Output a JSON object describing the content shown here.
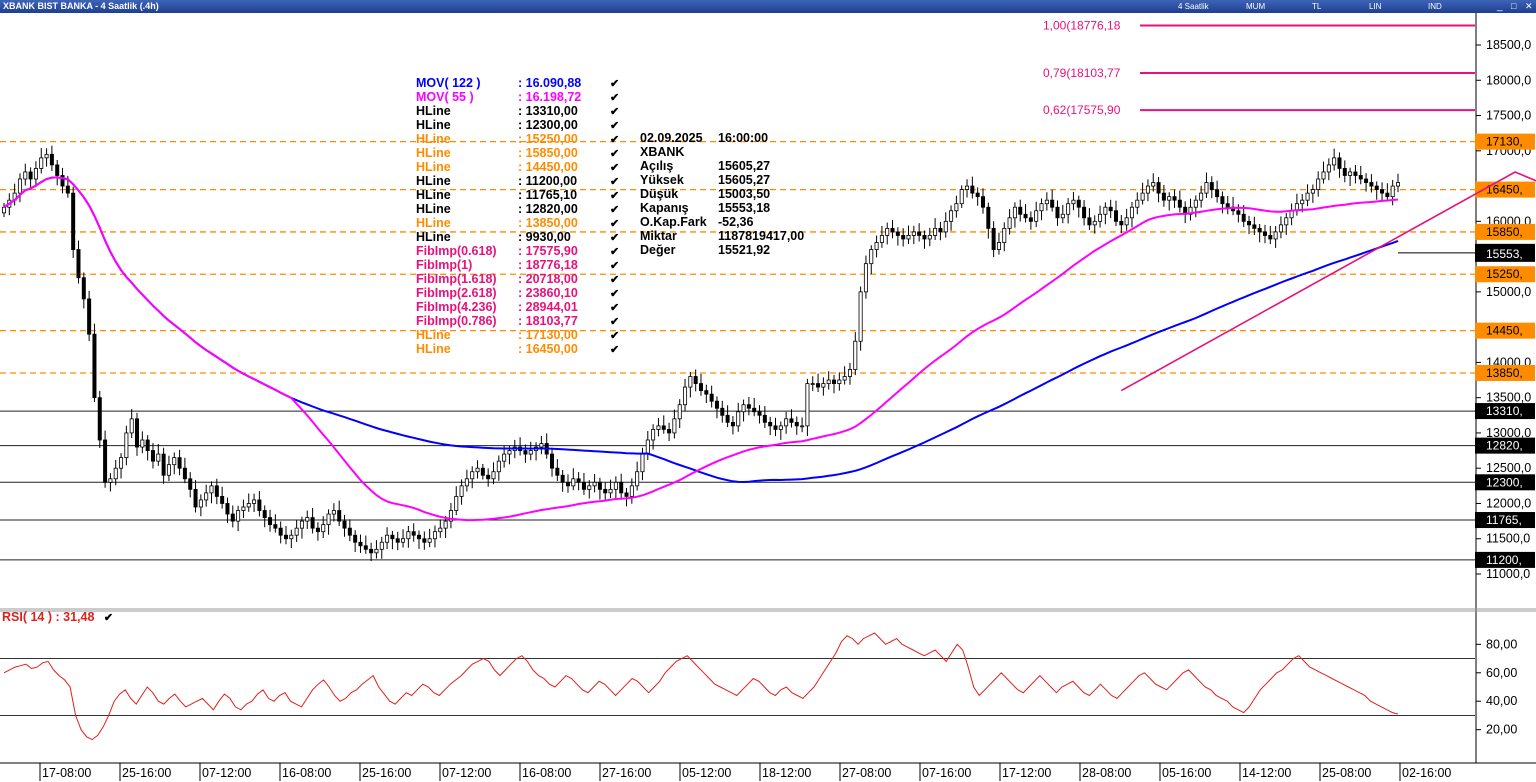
{
  "window": {
    "title": "XBANK BIST BANKA - 4 Saatlik (.4h)",
    "toolbar": [
      "4 Saatlik",
      "MUM",
      "TL",
      "LIN",
      "IND"
    ]
  },
  "legend": [
    {
      "name": "MOV( 122 )",
      "value": ": 16.090,88",
      "color": "#0000ff"
    },
    {
      "name": "MOV( 55 )",
      "value": ": 16.198,72",
      "color": "#ff00ff"
    },
    {
      "name": "HLine",
      "value": ": 13310,00",
      "color": "#000000"
    },
    {
      "name": "HLine",
      "value": ": 12300,00",
      "color": "#000000"
    },
    {
      "name": "HLine",
      "value": ": 15250,00",
      "color": "#ff8c00"
    },
    {
      "name": "HLine",
      "value": ": 15850,00",
      "color": "#ff8c00"
    },
    {
      "name": "HLine",
      "value": ": 14450,00",
      "color": "#ff8c00"
    },
    {
      "name": "HLine",
      "value": ": 11200,00",
      "color": "#000000"
    },
    {
      "name": "HLine",
      "value": ": 11765,10",
      "color": "#000000"
    },
    {
      "name": "HLine",
      "value": ": 12820,00",
      "color": "#000000"
    },
    {
      "name": "HLine",
      "value": ": 13850,00",
      "color": "#ff8c00"
    },
    {
      "name": "HLine",
      "value": ": 9930,00",
      "color": "#000000"
    },
    {
      "name": "FibImp(0.618)",
      "value": ": 17575,90",
      "color": "#e8117c"
    },
    {
      "name": "FibImp(1)",
      "value": ": 18776,18",
      "color": "#e8117c"
    },
    {
      "name": "FibImp(1.618)",
      "value": ": 20718,00",
      "color": "#e8117c"
    },
    {
      "name": "FibImp(2.618)",
      "value": ": 23860,10",
      "color": "#e8117c"
    },
    {
      "name": "FibImp(4.236)",
      "value": ": 28944,01",
      "color": "#e8117c"
    },
    {
      "name": "FibImp(0.786)",
      "value": ": 18103,77",
      "color": "#e8117c"
    },
    {
      "name": "HLine",
      "value": ": 17130,00",
      "color": "#ff8c00"
    },
    {
      "name": "HLine",
      "value": ": 16450,00",
      "color": "#ff8c00"
    }
  ],
  "ohlc": [
    {
      "k": "02.09.2025",
      "v": "16:00:00"
    },
    {
      "k": "XBANK",
      "v": ""
    },
    {
      "k": "Açılış",
      "v": "15605,27"
    },
    {
      "k": "Yüksek",
      "v": "15605,27"
    },
    {
      "k": "Düşük",
      "v": "15003,50"
    },
    {
      "k": "Kapanış",
      "v": "15553,18"
    },
    {
      "k": "O.Kap.Fark",
      "v": "-52,36"
    },
    {
      "k": "Miktar",
      "v": "1187819417,00"
    },
    {
      "k": "Değer",
      "v": "15521,92"
    }
  ],
  "rsi_label": "RSI( 14 )   : 31,48",
  "chart_data": [
    {
      "type": "candlestick",
      "y_ticks": [
        "18500,0",
        "18000,0",
        "17500,0",
        "17000,0",
        "16000,0",
        "15000,0",
        "14000,0",
        "13500,0",
        "13000,0",
        "12500,0",
        "12000,0",
        "11500,0",
        "11000,0"
      ],
      "x_ticks": [
        "17-08:00",
        "25-16:00",
        "07-12:00",
        "16-08:00",
        "25-16:00",
        "07-12:00",
        "16-08:00",
        "27-16:00",
        "05-12:00",
        "18-12:00",
        "27-08:00",
        "07-16:00",
        "17-12:00",
        "28-08:00",
        "05-16:00",
        "14-12:00",
        "25-08:00",
        "02-16:00"
      ],
      "ylim": [
        10800,
        19000
      ],
      "hlines_orange": [
        {
          "value": 17130,
          "label": "17130,"
        },
        {
          "value": 16450,
          "label": "16450,"
        },
        {
          "value": 15850,
          "label": "15850,"
        },
        {
          "value": 15250,
          "label": "15250,"
        },
        {
          "value": 14450,
          "label": "14450,"
        },
        {
          "value": 13850,
          "label": "13850,"
        }
      ],
      "hlines_black": [
        {
          "value": 13310,
          "label": "13310,"
        },
        {
          "value": 12820,
          "label": "12820,"
        },
        {
          "value": 12300,
          "label": "12300,"
        },
        {
          "value": 11765.1,
          "label": "11765,"
        },
        {
          "value": 11200,
          "label": "11200,"
        }
      ],
      "fib_levels": [
        {
          "value": 18776.18,
          "label": "1,00(18776,18"
        },
        {
          "value": 18103.77,
          "label": "0,79(18103,77"
        },
        {
          "value": 17575.9,
          "label": "0,62(17575,90"
        }
      ],
      "last_price": {
        "value": 15553.18,
        "label": "15553,"
      },
      "fib_swing": [
        {
          "i": 210,
          "y": 13600
        },
        {
          "i": 284,
          "y": 16700
        },
        {
          "i": 314,
          "y": 15750
        }
      ],
      "mov_55_color": "#ff00ff",
      "mov_122_color": "#0000ff",
      "close": [
        16200,
        16300,
        16400,
        16600,
        16700,
        16600,
        16750,
        16900,
        16950,
        16800,
        16650,
        16500,
        16400,
        15600,
        15200,
        14900,
        14400,
        13500,
        12900,
        12300,
        12350,
        12500,
        12650,
        13000,
        13200,
        12800,
        12900,
        12750,
        12600,
        12700,
        12400,
        12550,
        12650,
        12500,
        12350,
        12200,
        11950,
        12050,
        12150,
        12250,
        12100,
        12000,
        11850,
        11750,
        11900,
        11950,
        12000,
        12050,
        11900,
        11800,
        11700,
        11650,
        11550,
        11500,
        11550,
        11650,
        11750,
        11800,
        11650,
        11600,
        11700,
        11850,
        11900,
        11750,
        11650,
        11550,
        11450,
        11400,
        11350,
        11300,
        11350,
        11450,
        11550,
        11500,
        11450,
        11500,
        11600,
        11550,
        11500,
        11450,
        11500,
        11600,
        11650,
        11750,
        11900,
        12100,
        12250,
        12350,
        12450,
        12500,
        12400,
        12350,
        12450,
        12600,
        12700,
        12750,
        12800,
        12750,
        12700,
        12750,
        12800,
        12850,
        12700,
        12500,
        12400,
        12300,
        12250,
        12350,
        12300,
        12200,
        12250,
        12300,
        12200,
        12150,
        12200,
        12300,
        12150,
        12100,
        12250,
        12450,
        12700,
        12900,
        13050,
        13100,
        13050,
        13000,
        13200,
        13400,
        13650,
        13800,
        13700,
        13600,
        13550,
        13450,
        13350,
        13250,
        13150,
        13100,
        13300,
        13400,
        13350,
        13300,
        13250,
        13150,
        13100,
        13050,
        13100,
        13200,
        13150,
        13100,
        13100,
        13700,
        13700,
        13650,
        13700,
        13750,
        13700,
        13750,
        13800,
        13900,
        14300,
        15000,
        15400,
        15600,
        15700,
        15800,
        15900,
        15850,
        15800,
        15750,
        15800,
        15850,
        15800,
        15750,
        15800,
        15900,
        15850,
        16000,
        16150,
        16250,
        16450,
        16500,
        16400,
        16350,
        16200,
        15900,
        15600,
        15700,
        15900,
        16050,
        16200,
        16100,
        16050,
        16000,
        16150,
        16250,
        16300,
        16200,
        16050,
        16100,
        16250,
        16300,
        16200,
        16050,
        15950,
        16000,
        16100,
        16200,
        16150,
        16000,
        15950,
        16050,
        16200,
        16300,
        16400,
        16500,
        16550,
        16400,
        16300,
        16350,
        16300,
        16200,
        16100,
        16200,
        16300,
        16400,
        16550,
        16450,
        16350,
        16250,
        16200,
        16150,
        16100,
        16000,
        15950,
        15900,
        15850,
        15800,
        15750,
        15850,
        15950,
        16050,
        16150,
        16250,
        16300,
        16400,
        16450,
        16600,
        16700,
        16800,
        16900,
        16750,
        16650,
        16700,
        16650,
        16600,
        16550,
        16500,
        16450,
        16400,
        16350,
        16500,
        16550
      ],
      "rsi": {
        "ticks": [
          "80,00",
          "60,00",
          "40,00",
          "20,00"
        ],
        "ylim": [
          5,
          95
        ],
        "levels": [
          70,
          30
        ],
        "values": [
          60,
          62,
          64,
          65,
          66,
          63,
          64,
          67,
          68,
          62,
          58,
          55,
          50,
          30,
          20,
          15,
          13,
          16,
          22,
          30,
          40,
          45,
          48,
          42,
          38,
          44,
          50,
          46,
          40,
          38,
          42,
          45,
          40,
          36,
          38,
          40,
          42,
          38,
          34,
          40,
          45,
          42,
          36,
          34,
          38,
          40,
          45,
          48,
          42,
          40,
          44,
          46,
          40,
          38,
          36,
          42,
          48,
          52,
          55,
          50,
          44,
          40,
          42,
          46,
          48,
          52,
          55,
          58,
          50,
          45,
          40,
          38,
          42,
          46,
          44,
          48,
          52,
          50,
          46,
          44,
          48,
          52,
          55,
          58,
          62,
          66,
          68,
          70,
          68,
          62,
          58,
          62,
          66,
          70,
          72,
          68,
          62,
          58,
          56,
          52,
          50,
          54,
          58,
          56,
          52,
          48,
          46,
          50,
          54,
          52,
          48,
          44,
          48,
          52,
          56,
          54,
          50,
          46,
          50,
          54,
          60,
          64,
          68,
          70,
          72,
          68,
          64,
          60,
          56,
          52,
          50,
          48,
          46,
          44,
          48,
          52,
          56,
          54,
          50,
          46,
          44,
          48,
          50,
          46,
          44,
          42,
          46,
          50,
          56,
          62,
          68,
          74,
          82,
          86,
          84,
          80,
          84,
          86,
          88,
          84,
          80,
          82,
          84,
          80,
          78,
          76,
          74,
          72,
          74,
          76,
          72,
          68,
          74,
          80,
          76,
          64,
          50,
          44,
          48,
          52,
          56,
          60,
          56,
          52,
          48,
          46,
          50,
          54,
          58,
          54,
          50,
          46,
          50,
          52,
          54,
          50,
          46,
          44,
          48,
          52,
          48,
          44,
          42,
          46,
          50,
          54,
          58,
          60,
          56,
          52,
          50,
          48,
          52,
          56,
          60,
          62,
          58,
          54,
          50,
          48,
          44,
          42,
          40,
          36,
          34,
          32,
          36,
          42,
          48,
          52,
          56,
          60,
          62,
          66,
          70,
          72,
          68,
          64,
          62,
          60,
          58,
          56,
          54,
          52,
          50,
          48,
          46,
          44,
          40,
          38,
          36,
          34,
          32,
          31
        ]
      }
    }
  ]
}
